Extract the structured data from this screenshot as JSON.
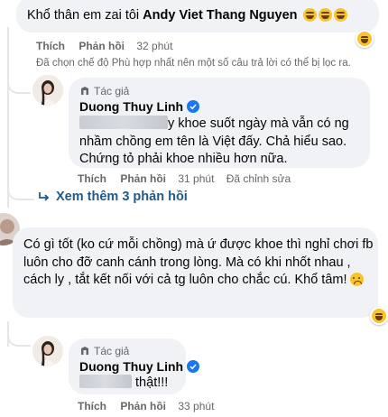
{
  "comment1": {
    "text": "Khổ thân em zai tôi ",
    "mention": "Andy Viet Thang Nguyen",
    "actions": {
      "like": "Thích",
      "reply": "Phản hồi",
      "time": "32 phút"
    },
    "filter_notice": "Đã chọn chế độ Phù hợp nhất nên một số câu trả lời có thể bị lọc ra."
  },
  "reply1": {
    "author_tag": "Tác giả",
    "author": "Duong Thuy Linh",
    "text_line1": "y khoe suốt ngày mà vẫn có ng",
    "text_rest": "nhầm chồng em tên là Việt đấy. Chả hiểu sao. Chứng tỏ phải khoe nhiều hơn nữa.",
    "actions": {
      "like": "Thích",
      "reply": "Phản hồi",
      "time": "31 phút",
      "edited": "Đã chỉnh sửa"
    }
  },
  "more_replies": {
    "label": "Xem thêm 3 phản hồi"
  },
  "comment2": {
    "text": "Có gì tốt (ko cứ mỗi chồng) mà ứ được khoe thì nghỉ chơi fb luôn cho đỡ canh cánh trong lòng. Mà có khi nhốt nhau , cách ly , tắt kết nối với cả tg luôn cho chắc cú. Khổ tâm!"
  },
  "reply2": {
    "author_tag": "Tác giả",
    "author": "Duong Thuy Linh",
    "text": "thật!!!",
    "actions": {
      "like": "Thích",
      "reply": "Phản hồi",
      "time": "33 phút"
    }
  },
  "icons": {
    "laugh": "laughing-emoji-icon",
    "sad": "sad-emoji-icon",
    "verified": "verified-badge-icon",
    "author": "author-badge-icon",
    "reply_arrow": "reply-arrow-icon"
  },
  "colors": {
    "bubble": "#f0f2f5",
    "muted": "#65676b",
    "link": "#1877f2",
    "text": "#050505"
  }
}
